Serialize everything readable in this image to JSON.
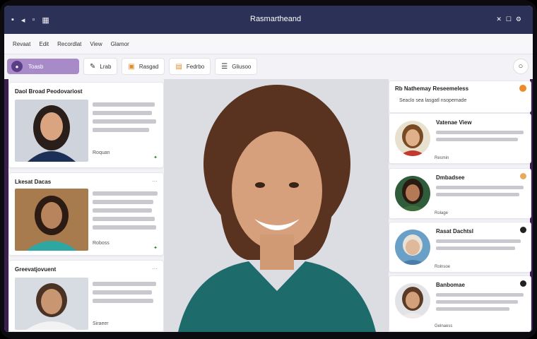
{
  "app": {
    "title": "Rasmartheand"
  },
  "menubar": {
    "items": [
      "Revaat",
      "Edit",
      "Recordlat",
      "View",
      "Glamor"
    ]
  },
  "toolbar": {
    "primary_label": "Toasb",
    "chips": [
      "Lrab",
      "Rasgad",
      "Fedrbo",
      "Gliusoo"
    ]
  },
  "left_cards": [
    {
      "title": "Daol Broad Peodovariost",
      "footer": "Roquan"
    },
    {
      "title": "Lkesat Dacas",
      "footer": "Roboss"
    },
    {
      "title": "Greevatjovuent",
      "footer": "Siraeer"
    }
  ],
  "right_panel": {
    "header": "Rb Nathemay Reseemeless",
    "subheader": "Seaclo sea lasgatl nsopemade"
  },
  "right_cards": [
    {
      "name": "Vatenae View",
      "footer": "Resmin"
    },
    {
      "name": "Dmbadsee",
      "footer": "Rolage"
    },
    {
      "name": "Rasat Dachtsl",
      "footer": "Rolnsoe"
    },
    {
      "name": "Banbomae",
      "footer": "Gelnaess"
    }
  ],
  "colors": {
    "appbar": "#2b3157",
    "accent": "#a88ac9",
    "strip": "#3b1f4d"
  }
}
